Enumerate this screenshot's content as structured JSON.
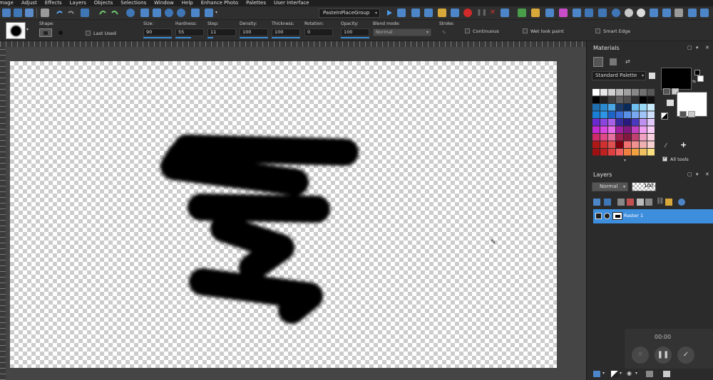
{
  "menu": [
    "Image",
    "Adjust",
    "Effects",
    "Layers",
    "Objects",
    "Selections",
    "Window",
    "Help",
    "Enhance Photo",
    "Palettes",
    "User Interface"
  ],
  "toolbar": {
    "script_name": "PasteInPlaceGroup",
    "script_dropdown_icon": "chevron-down-icon"
  },
  "options": {
    "shape_label": "Shape:",
    "last_used_label": "Last Used",
    "size_label": "Size:",
    "size_value": "90",
    "hardness_label": "Hardness:",
    "hardness_value": "55",
    "step_label": "Step:",
    "step_value": "11",
    "density_label": "Density:",
    "density_value": "100",
    "thickness_label": "Thickness:",
    "thickness_value": "100",
    "rotation_label": "Rotation:",
    "rotation_value": "0",
    "opacity_label": "Opacity:",
    "opacity_value": "100",
    "blend_label": "Blend mode:",
    "blend_value": "Normal",
    "stroke_label": "Stroke:",
    "continuous_label": "Continuous",
    "wet_label": "Wet look paint",
    "smart_edge_label": "Smart Edge"
  },
  "materials": {
    "title": "Materials",
    "palette_select": "Standard Palette",
    "all_tools_label": "All tools",
    "foreground_color": "#000000",
    "background_color": "#ffffff"
  },
  "layers": {
    "title": "Layers",
    "blend_mode": "Normal",
    "opacity": "100",
    "layer_name": "Raster 1"
  },
  "recording": {
    "time": "00:00"
  },
  "colors": {
    "accent": "#3e8ede",
    "highlight_blue": "#3d8fd6"
  }
}
